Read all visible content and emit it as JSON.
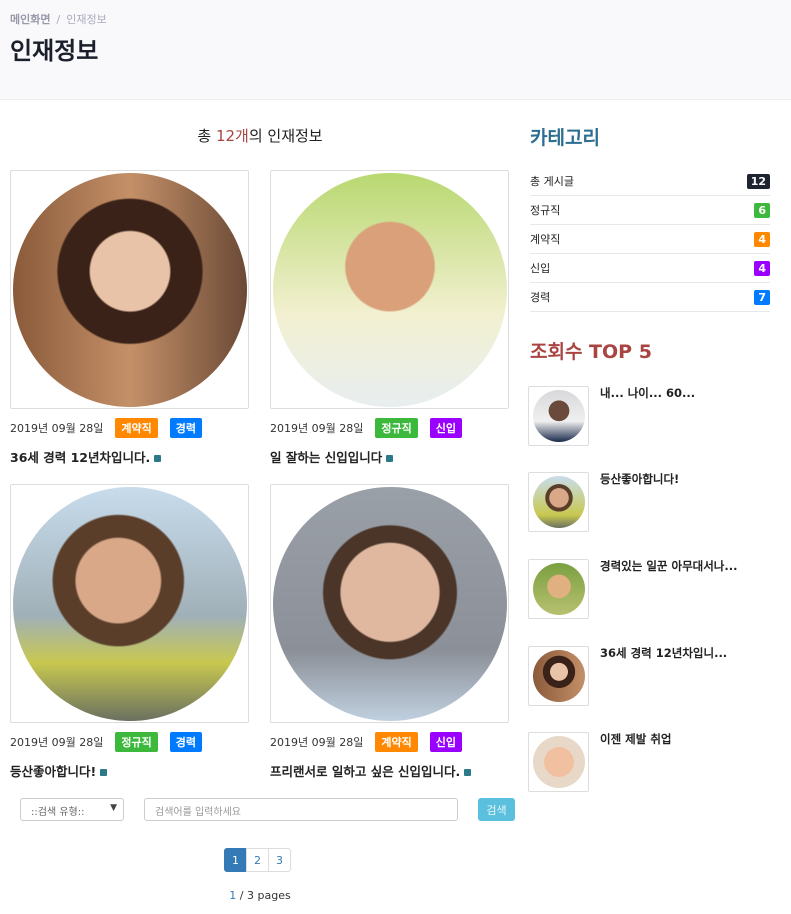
{
  "breadcrumb": {
    "home": "메인화면",
    "sep": "/",
    "current": "인재정보"
  },
  "page_title": "인재정보",
  "summary": {
    "prefix": "총 ",
    "count": "12개",
    "suffix": "의 인재정보"
  },
  "cards": [
    {
      "date": "2019년 09월 28일",
      "badges": [
        {
          "label": "계약직",
          "color": "#ff8800"
        },
        {
          "label": "경력",
          "color": "#007bff"
        }
      ],
      "title": "36세 경력 12년차입니다."
    },
    {
      "date": "2019년 09월 28일",
      "badges": [
        {
          "label": "정규직",
          "color": "#3cb83c"
        },
        {
          "label": "신입",
          "color": "#9900ff"
        }
      ],
      "title": "일 잘하는 신입입니다"
    },
    {
      "date": "2019년 09월 28일",
      "badges": [
        {
          "label": "정규직",
          "color": "#3cb83c"
        },
        {
          "label": "경력",
          "color": "#007bff"
        }
      ],
      "title": "등산좋아합니다!"
    },
    {
      "date": "2019년 09월 28일",
      "badges": [
        {
          "label": "계약직",
          "color": "#ff8800"
        },
        {
          "label": "신입",
          "color": "#9900ff"
        }
      ],
      "title": "프리랜서로 일하고 싶은 신입입니다."
    }
  ],
  "search": {
    "type_placeholder": "::검색 유형::",
    "input_placeholder": "검색어를 입력하세요",
    "button": "검색"
  },
  "pagination": {
    "pages": [
      "1",
      "2",
      "3"
    ],
    "current": "1",
    "info_current": "1",
    "info_rest": " / 3 pages"
  },
  "sidebar": {
    "category_title": "카테고리",
    "categories": [
      {
        "label": "총 게시글",
        "count": "12",
        "color": "#1e2430"
      },
      {
        "label": "정규직",
        "count": "6",
        "color": "#3cb83c"
      },
      {
        "label": "계약직",
        "count": "4",
        "color": "#ff8800"
      },
      {
        "label": "신입",
        "count": "4",
        "color": "#9900ff"
      },
      {
        "label": "경력",
        "count": "7",
        "color": "#007bff"
      }
    ],
    "top_title": "조회수 TOP 5",
    "top": [
      {
        "title": "내... 나이... 60..."
      },
      {
        "title": "등산좋아합니다!"
      },
      {
        "title": "경력있는 일꾼 아무대서나..."
      },
      {
        "title": "36세 경력 12년차입니..."
      },
      {
        "title": "이젠 제발 취업"
      }
    ]
  }
}
